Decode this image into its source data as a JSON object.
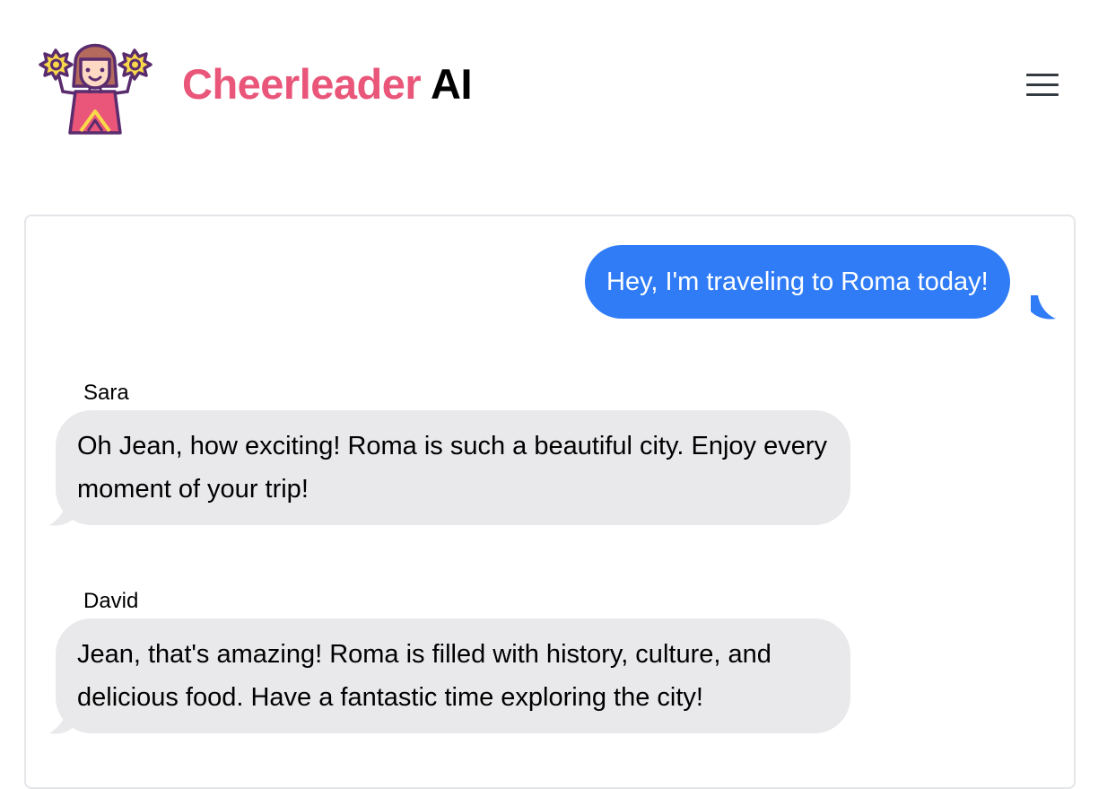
{
  "app": {
    "brand_accent": "Cheerleader",
    "brand_rest": " AI",
    "brand_accent_color": "#e9567a",
    "logo_icon": "cheerleader-icon",
    "menu_icon": "hamburger-menu-icon"
  },
  "chat": {
    "outgoing": {
      "text": "Hey, I'm traveling to Roma today!",
      "color": "#2f7cf6"
    },
    "messages": [
      {
        "sender": "Sara",
        "text": "Oh Jean, how exciting! Roma is such a beautiful city. Enjoy every moment of your trip!"
      },
      {
        "sender": "David",
        "text": "Jean, that's amazing! Roma is filled with history, culture, and delicious food. Have a fantastic time exploring the city!"
      }
    ],
    "incoming_color": "#e9e9eb"
  }
}
